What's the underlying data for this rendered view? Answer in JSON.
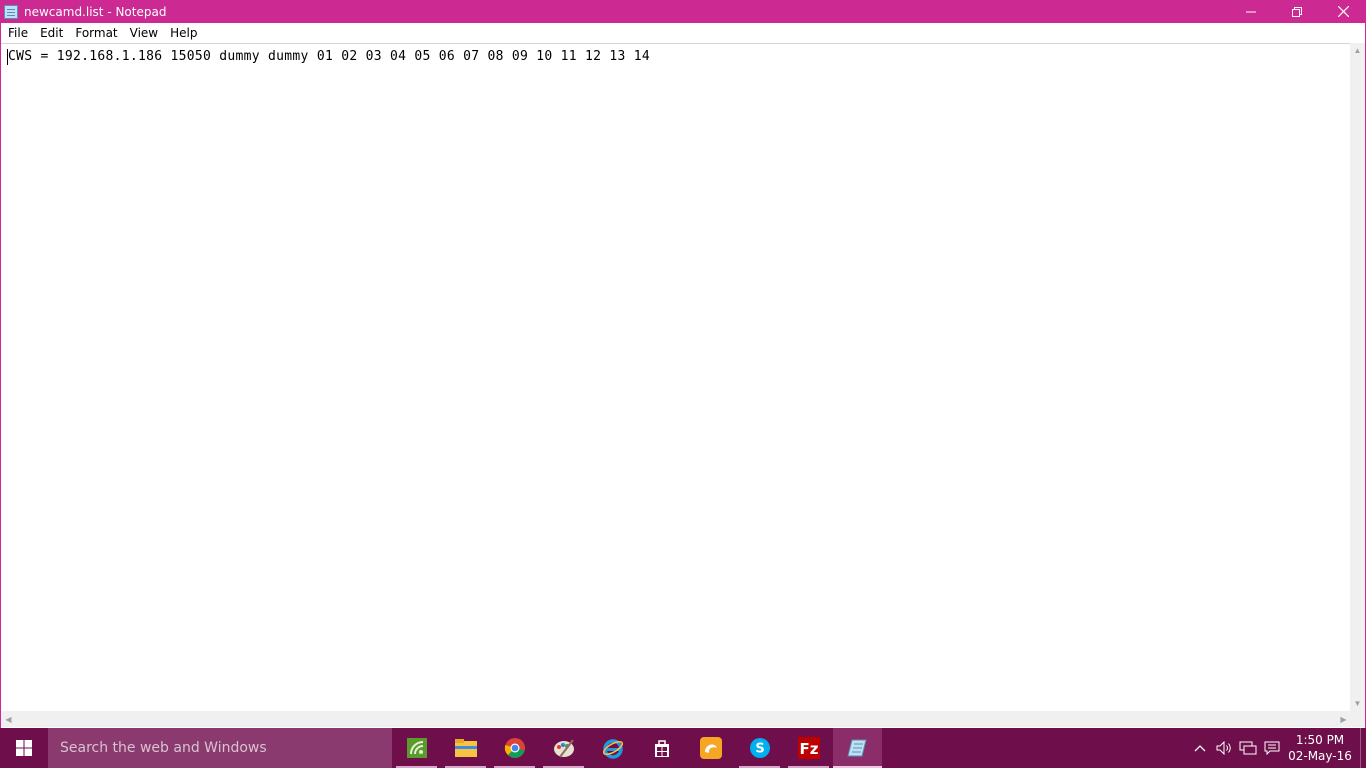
{
  "window": {
    "title": "newcamd.list - Notepad",
    "controls": {
      "minimize": "—",
      "maximize": "❐",
      "close": "✕"
    }
  },
  "menu": {
    "items": [
      "File",
      "Edit",
      "Format",
      "View",
      "Help"
    ]
  },
  "editor": {
    "content": "CWS = 192.168.1.186 15050 dummy dummy 01 02 03 04 05 06 07 08 09 10 11 12 13 14"
  },
  "taskbar": {
    "search_placeholder": "Search the web and Windows",
    "apps": [
      {
        "icon": "network-app-icon",
        "open": true
      },
      {
        "icon": "file-explorer-icon",
        "open": true
      },
      {
        "icon": "chrome-icon",
        "open": true
      },
      {
        "icon": "paint-icon",
        "open": true
      },
      {
        "icon": "internet-explorer-icon",
        "open": false
      },
      {
        "icon": "store-icon",
        "open": false
      },
      {
        "icon": "uc-browser-icon",
        "open": false
      },
      {
        "icon": "skype-icon",
        "open": true
      },
      {
        "icon": "filezilla-icon",
        "open": true
      },
      {
        "icon": "notepad-icon",
        "open": true,
        "active": true
      }
    ],
    "clock": {
      "time": "1:50 PM",
      "date": "02-May-16"
    }
  },
  "colors": {
    "accent": "#cc2a92",
    "taskbar": "#6e0e4a",
    "search": "#8a3a6e"
  }
}
